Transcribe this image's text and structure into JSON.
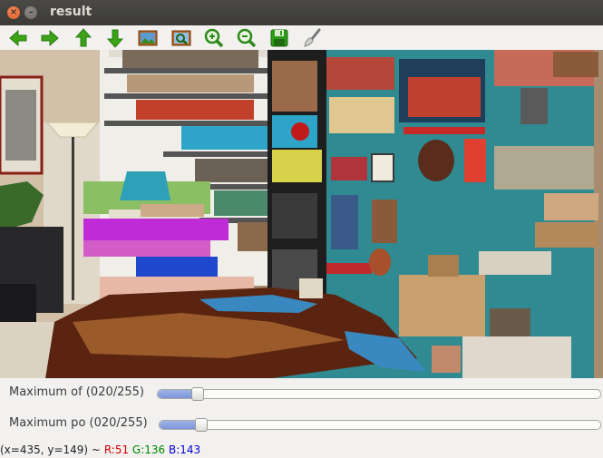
{
  "window": {
    "title": "result"
  },
  "toolbar": {
    "tools": [
      {
        "icon": "arrow-left-icon"
      },
      {
        "icon": "arrow-right-icon"
      },
      {
        "icon": "arrow-up-icon"
      },
      {
        "icon": "arrow-down-icon"
      },
      {
        "icon": "image-icon"
      },
      {
        "icon": "zoom-fit-icon"
      },
      {
        "icon": "zoom-in-icon"
      },
      {
        "icon": "zoom-out-icon"
      },
      {
        "icon": "save-icon"
      },
      {
        "icon": "properties-brush-icon"
      }
    ]
  },
  "trackbars": [
    {
      "label": "Maximum of (020/255)",
      "value": 20,
      "max": 255
    },
    {
      "label": "Maximum po (020/255)",
      "value": 20,
      "max": 255
    }
  ],
  "status": {
    "coords": "(x=435, y=149) ~",
    "r": "R:51",
    "g": "G:136",
    "b": "B:143"
  },
  "colors": {
    "accent_red": "#e25a23",
    "status_r": "#d40000",
    "status_g": "#008800",
    "status_b": "#0000cc",
    "mask_teal": "#2f8a92"
  }
}
